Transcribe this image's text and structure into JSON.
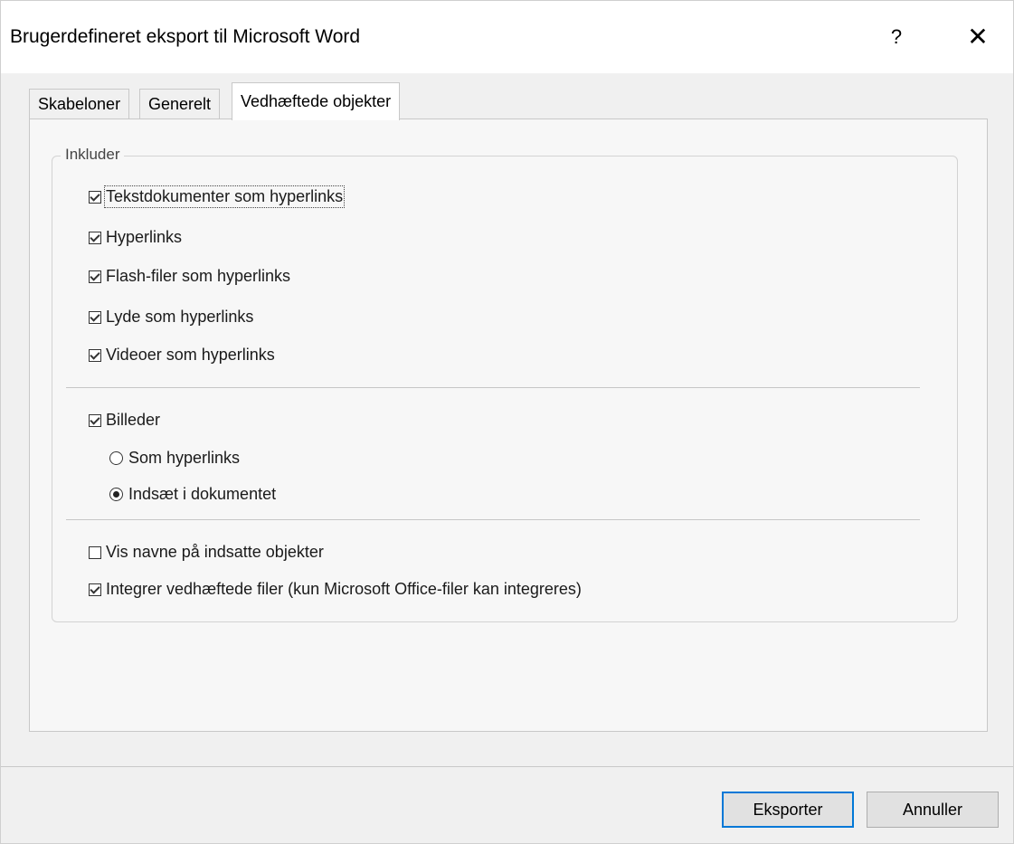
{
  "window": {
    "title": "Brugerdefineret eksport til Microsoft Word",
    "help_label": "?",
    "close_label": "✕"
  },
  "tabs": [
    {
      "label": "Skabeloner",
      "active": false
    },
    {
      "label": "Generelt",
      "active": false
    },
    {
      "label": "Vedhæftede objekter",
      "active": true
    }
  ],
  "include_group": {
    "legend": "Inkluder",
    "hyperlink_options": [
      {
        "label": "Tekstdokumenter som hyperlinks",
        "checked": true
      },
      {
        "label": "Hyperlinks",
        "checked": true
      },
      {
        "label": "Flash-filer som hyperlinks",
        "checked": true
      },
      {
        "label": "Lyde som hyperlinks",
        "checked": true
      },
      {
        "label": "Videoer som hyperlinks",
        "checked": true
      }
    ],
    "images": {
      "label": "Billeder",
      "checked": true,
      "radio_options": [
        {
          "label": "Som hyperlinks",
          "selected": false
        },
        {
          "label": "Indsæt i dokumentet",
          "selected": true
        }
      ]
    },
    "other_options": [
      {
        "label": "Vis navne på indsatte objekter",
        "checked": false
      },
      {
        "label": "Integrer vedhæftede filer (kun Microsoft Office-filer kan integreres)",
        "checked": true
      }
    ]
  },
  "buttons": {
    "export_label": "Eksporter",
    "cancel_label": "Annuller"
  }
}
